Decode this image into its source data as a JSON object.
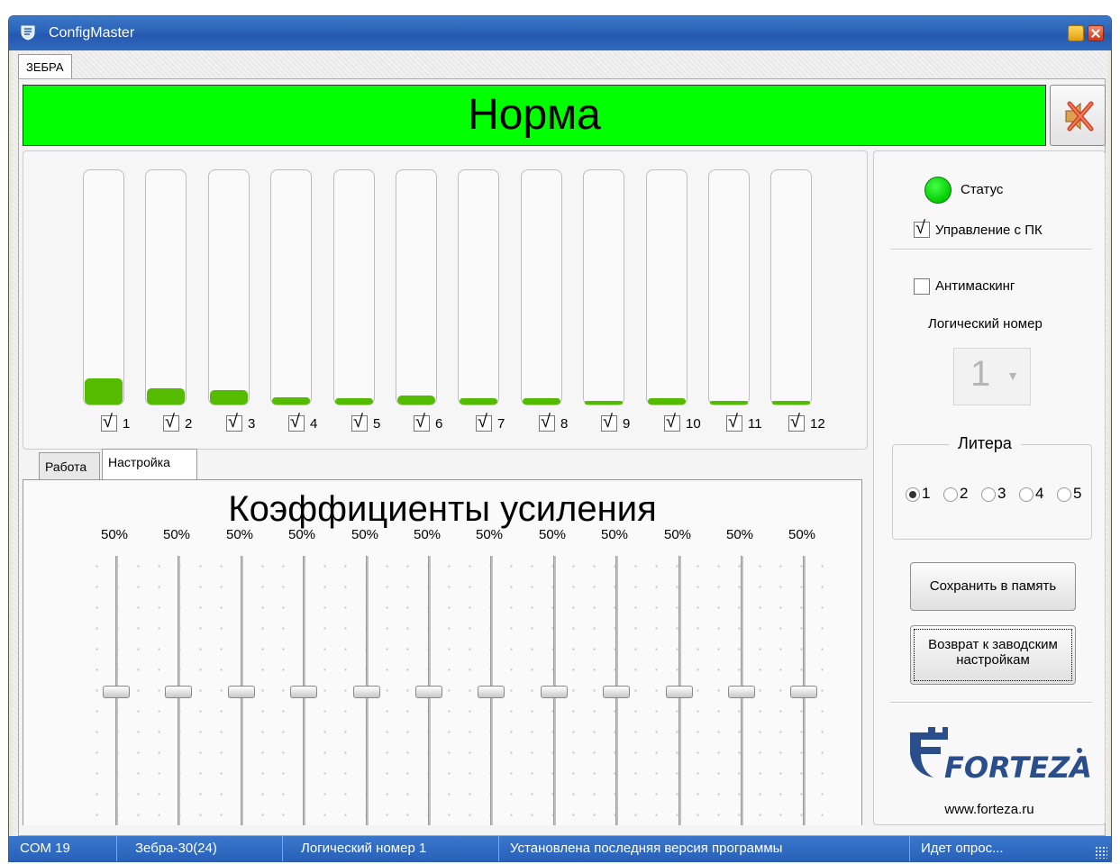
{
  "window": {
    "title": "ConfigMaster",
    "app_icon": "shield-icon"
  },
  "device_tab": "ЗЕБРА",
  "status_banner": {
    "text": "Норма",
    "color": "#00ff00"
  },
  "mute_button": {
    "icon": "speaker-muted-icon"
  },
  "channels": [
    {
      "label": "1",
      "checked": true,
      "level": 0.11
    },
    {
      "label": "2",
      "checked": true,
      "level": 0.07
    },
    {
      "label": "3",
      "checked": true,
      "level": 0.06
    },
    {
      "label": "4",
      "checked": true,
      "level": 0.03
    },
    {
      "label": "5",
      "checked": true,
      "level": 0.025
    },
    {
      "label": "6",
      "checked": true,
      "level": 0.04
    },
    {
      "label": "7",
      "checked": true,
      "level": 0.025
    },
    {
      "label": "8",
      "checked": true,
      "level": 0.025
    },
    {
      "label": "9",
      "checked": true,
      "level": 0.015
    },
    {
      "label": "10",
      "checked": true,
      "level": 0.025
    },
    {
      "label": "11",
      "checked": true,
      "level": 0.015
    },
    {
      "label": "12",
      "checked": true,
      "level": 0.015
    }
  ],
  "work_tabs": [
    {
      "label": "Работа",
      "active": false
    },
    {
      "label": "Настройка",
      "active": true
    }
  ],
  "coefficients": {
    "title": "Коэффициенты усиления",
    "values": [
      "50%",
      "50%",
      "50%",
      "50%",
      "50%",
      "50%",
      "50%",
      "50%",
      "50%",
      "50%",
      "50%",
      "50%"
    ],
    "levels": [
      0.5,
      0.5,
      0.5,
      0.5,
      0.5,
      0.5,
      0.5,
      0.5,
      0.5,
      0.5,
      0.5,
      0.5
    ]
  },
  "side": {
    "status_label": "Статус",
    "status_color": "#00ff00",
    "pc_control_label": "Управление с ПК",
    "pc_control_checked": true,
    "antimasking_label": "Антимаскинг",
    "antimasking_checked": false,
    "logic_number_label": "Логический номер",
    "logic_number_value": "1",
    "litera_label": "Литера",
    "litera_options": [
      "1",
      "2",
      "3",
      "4",
      "5"
    ],
    "litera_selected": "1",
    "save_button": "Сохранить в память",
    "reset_button_line1": "Возврат к заводским",
    "reset_button_line2": "настройкам",
    "logo_icon": "forteza-logo",
    "logo_text": "FORTEZA",
    "website": "www.forteza.ru"
  },
  "statusbar": {
    "port": "COM 19",
    "device": "Зебра-30(24)",
    "logic": "Логический номер 1",
    "version": "Установлена последняя версия программы",
    "poll": "Идет опрос..."
  }
}
